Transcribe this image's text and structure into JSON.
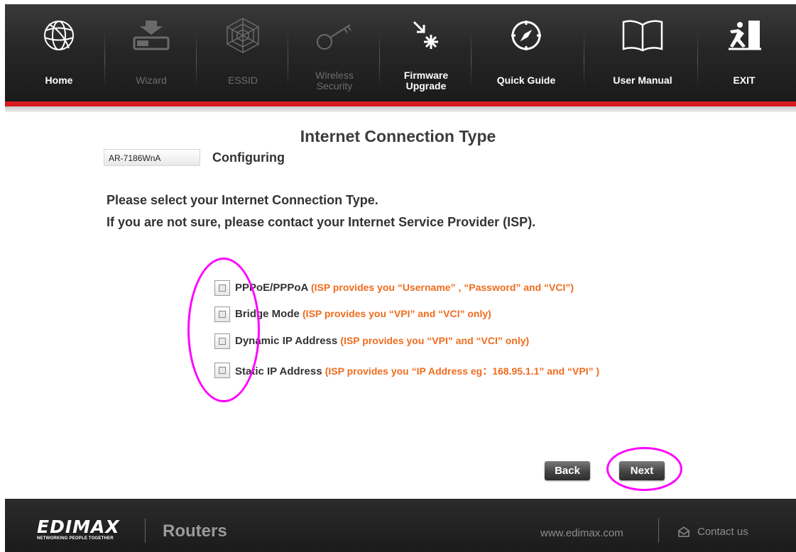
{
  "nav": {
    "items": [
      {
        "label": "Home",
        "icon": "globe-icon",
        "enabled": true
      },
      {
        "label": "Wizard",
        "icon": "router-download-icon",
        "enabled": false
      },
      {
        "label": "ESSID",
        "icon": "web-icon",
        "enabled": false
      },
      {
        "label_1": "Wireless",
        "label_2": "Security",
        "icon": "key-icon",
        "enabled": false
      },
      {
        "label_1": "Firmware",
        "label_2": "Upgrade",
        "icon": "firmware-upgrade-icon",
        "enabled": true
      },
      {
        "label": "Quick Guide",
        "icon": "compass-icon",
        "enabled": true
      },
      {
        "label": "User Manual",
        "icon": "open-book-icon",
        "enabled": true
      },
      {
        "label": "EXIT",
        "icon": "exit-runner-icon",
        "enabled": true
      }
    ]
  },
  "main": {
    "title": "Internet Connection Type",
    "model": "AR-7186WnA",
    "status": "Configuring",
    "instruction_1": "Please select your Internet Connection Type.",
    "instruction_2": "If you are not sure, please contact your Internet Service Provider (ISP).",
    "options": [
      {
        "name": "PPPoE/PPPoA",
        "desc": "(ISP provides you “Username” , “Password” and “VCI”)",
        "checked": false
      },
      {
        "name": "Bridge Mode",
        "desc": "(ISP provides you “VPI” and “VCI” only)",
        "checked": false
      },
      {
        "name": "Dynamic IP Address",
        "desc": "(ISP provides you “VPI” and “VCI” only)",
        "checked": false
      },
      {
        "name": "Static IP Address",
        "desc": "(ISP provides you “IP Address eg：168.95.1.1” and “VPI” )",
        "checked": false
      }
    ],
    "back_label": "Back",
    "next_label": "Next"
  },
  "footer": {
    "brand": "EDIMAX",
    "tagline": "NETWORKING PEOPLE TOGETHER",
    "product": "Routers",
    "website": "www.edimax.com",
    "contact": "Contact us"
  },
  "colors": {
    "accent_red": "#d71920",
    "option_desc": "#ef6c1e",
    "annotation": "#ff00ff"
  }
}
